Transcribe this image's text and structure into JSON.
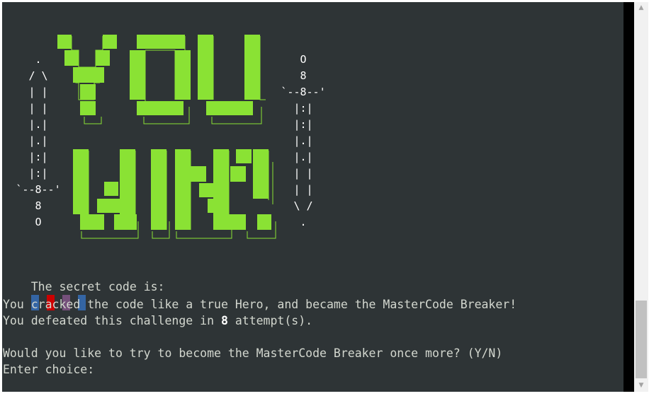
{
  "ascii": {
    "left": [
      ".",
      "/ \\",
      "| |",
      "| |",
      "|.|",
      "|.|",
      "|:|",
      "|:|",
      "`--8--'",
      "8",
      "O"
    ],
    "right": [
      "O",
      "8",
      "`--8--'",
      "|:|",
      "|:|",
      "|.|",
      "|.|",
      "| |",
      "| |",
      "\\ /",
      "."
    ]
  },
  "banner": {
    "line1": "YOU",
    "line2": "WIN!",
    "color": "#8ae234"
  },
  "output": {
    "secret_label": "The secret code is: ",
    "code_colors": [
      "#3465a4",
      "#cc0000",
      "#75507b",
      "#3465a4"
    ],
    "line_cracked": "You cracked the code like a true Hero, and became the MasterCode Breaker!",
    "defeated_prefix": "You defeated this challenge in ",
    "attempts": "8",
    "defeated_suffix": " attempt(s).",
    "prompt_again": "Would you like to try to become the MasterCode Breaker once more? (Y/N)",
    "enter_choice": "Enter choice:"
  },
  "scrollbar": {
    "up": "▲",
    "down": "▼"
  }
}
